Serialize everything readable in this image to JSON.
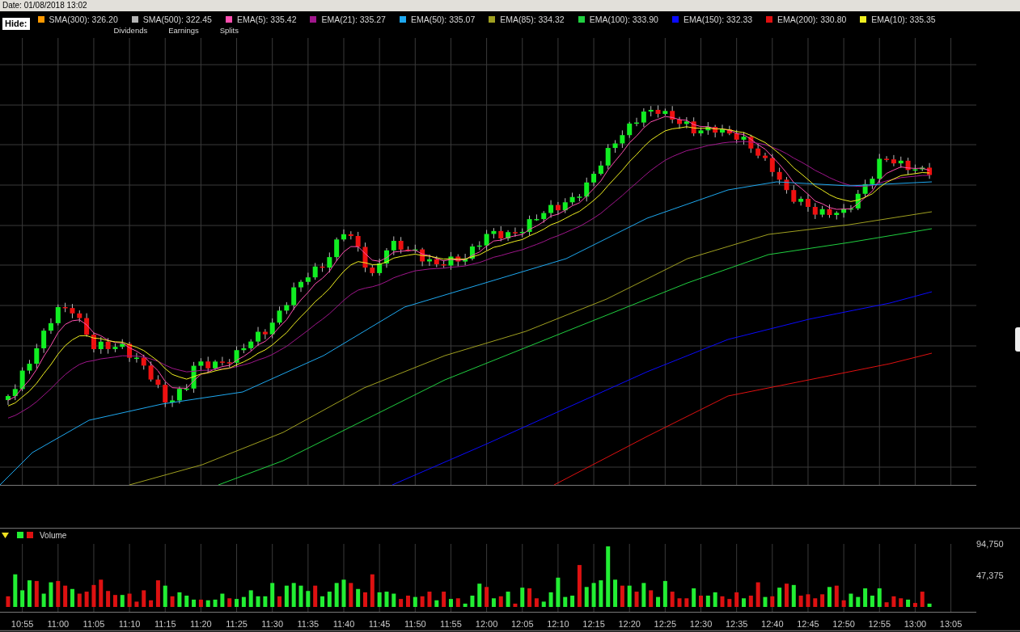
{
  "header": {
    "date": "Date: 01/08/2018 13:02"
  },
  "hide_button": "Hide:",
  "indicators": [
    {
      "label": "SMA(300): 326.20",
      "color": "#ff9900"
    },
    {
      "label": "SMA(500): 322.45",
      "color": "#b4b4b4"
    },
    {
      "label": "EMA(5): 335.42",
      "color": "#ff4fb0"
    },
    {
      "label": "EMA(21): 335.27",
      "color": "#a0168c"
    },
    {
      "label": "EMA(50): 335.07",
      "color": "#1ea8f0"
    },
    {
      "label": "EMA(85): 334.32",
      "color": "#a0a020"
    },
    {
      "label": "EMA(100): 333.90",
      "color": "#20d040"
    },
    {
      "label": "EMA(150): 332.33",
      "color": "#0a0aff"
    },
    {
      "label": "EMA(200): 330.80",
      "color": "#e01010"
    },
    {
      "label": "EMA(10): 335.35",
      "color": "#f0f020"
    }
  ],
  "events": [
    "Dividends",
    "Earnings",
    "Splits"
  ],
  "volume": {
    "chart_data": {
      "type": "bar",
      "stacked": true,
      "grid": true,
      "x": [
        653,
        654,
        655,
        656,
        657,
        658,
        659,
        660,
        661,
        662,
        663,
        664,
        665,
        666,
        667,
        668,
        669,
        670,
        671,
        672,
        673,
        674,
        675,
        676,
        677,
        678,
        679,
        680,
        681,
        682,
        683,
        684,
        685,
        686,
        687,
        688,
        689,
        690,
        691,
        692,
        693,
        694,
        695,
        696,
        697,
        698,
        699,
        700,
        701,
        702,
        703,
        704,
        705,
        706,
        707,
        708,
        709,
        710,
        711,
        712,
        713,
        714,
        715,
        716,
        717,
        718,
        719,
        720,
        721,
        722,
        723,
        724,
        725,
        726,
        727,
        728,
        729,
        730,
        731,
        732,
        733,
        734,
        735,
        736,
        737,
        738,
        739,
        740,
        741,
        742,
        743,
        744,
        745,
        746,
        747,
        748,
        749,
        750,
        751,
        752,
        753,
        754,
        755,
        756,
        757,
        758,
        759,
        760,
        761,
        762,
        763,
        764,
        765,
        766,
        767,
        768,
        769,
        770,
        771,
        772,
        773,
        774,
        775,
        776,
        777,
        778,
        779,
        780,
        781,
        782
      ],
      "xlim": [
        651.87,
        788.56
      ],
      "ylim": [
        0,
        110500
      ],
      "xticks": [
        {
          "value": 655,
          "label": "10:55"
        },
        {
          "value": 660,
          "label": "11:00"
        },
        {
          "value": 665,
          "label": "11:05"
        },
        {
          "value": 670,
          "label": "11:10"
        },
        {
          "value": 675,
          "label": "11:15"
        },
        {
          "value": 680,
          "label": "11:20"
        },
        {
          "value": 685,
          "label": "11:25"
        },
        {
          "value": 690,
          "label": "11:30"
        },
        {
          "value": 695,
          "label": "11:35"
        },
        {
          "value": 700,
          "label": "11:40"
        },
        {
          "value": 705,
          "label": "11:45"
        },
        {
          "value": 710,
          "label": "11:50"
        },
        {
          "value": 715,
          "label": "11:55"
        },
        {
          "value": 720,
          "label": "12:00"
        },
        {
          "value": 725,
          "label": "12:05"
        },
        {
          "value": 730,
          "label": "12:10"
        },
        {
          "value": 735,
          "label": "12:15"
        },
        {
          "value": 740,
          "label": "12:20"
        },
        {
          "value": 745,
          "label": "12:25"
        },
        {
          "value": 750,
          "label": "12:30"
        },
        {
          "value": 755,
          "label": "12:35"
        },
        {
          "value": 760,
          "label": "12:40"
        },
        {
          "value": 765,
          "label": "12:45"
        },
        {
          "value": 770,
          "label": "12:50"
        },
        {
          "value": 775,
          "label": "12:55"
        },
        {
          "value": 780,
          "label": "13:00"
        },
        {
          "value": 785,
          "label": "13:05"
        }
      ],
      "yticks": [
        {
          "value": 47375,
          "label": "47,375"
        },
        {
          "value": 94750,
          "label": "94,750"
        }
      ],
      "series": [
        {
          "color": "#22ee33",
          "values": [
            null,
            49000,
            25000,
            40000,
            null,
            20000,
            37000,
            null,
            null,
            27000,
            null,
            null,
            null,
            null,
            null,
            null,
            18000,
            null,
            null,
            null,
            null,
            null,
            32000,
            null,
            22000,
            17000,
            11000,
            null,
            10000,
            11000,
            20000,
            null,
            12000,
            15000,
            25000,
            16000,
            16000,
            36000,
            null,
            32000,
            36000,
            32000,
            24000,
            null,
            16000,
            23000,
            36000,
            41000,
            null,
            27000,
            null,
            null,
            22000,
            23000,
            20000,
            null,
            null,
            15000,
            null,
            null,
            10000,
            null,
            12000,
            null,
            5000,
            17000,
            35000,
            null,
            13000,
            null,
            23000,
            null,
            29000,
            null,
            null,
            8000,
            22000,
            44000,
            15000,
            17000,
            null,
            30000,
            36000,
            40000,
            91000,
            41000,
            null,
            32000,
            null,
            36000,
            null,
            15000,
            39000,
            null,
            null,
            null,
            28000,
            null,
            17000,
            22000,
            null,
            null,
            null,
            13000,
            null,
            null,
            15000,
            null,
            29000,
            null,
            33000,
            null,
            null,
            null,
            null,
            30000,
            null,
            null,
            20000,
            15000,
            28000,
            17000,
            28000,
            null,
            null,
            null,
            11000,
            null,
            null,
            5000
          ]
        },
        {
          "name": "Volume",
          "color": "#dd1111",
          "values": [
            16000,
            null,
            null,
            null,
            39000,
            null,
            null,
            39000,
            32000,
            null,
            20000,
            23000,
            33000,
            41000,
            24000,
            18000,
            null,
            20000,
            8000,
            25000,
            10000,
            40000,
            null,
            16000,
            null,
            null,
            null,
            11000,
            null,
            null,
            null,
            13000,
            null,
            null,
            null,
            null,
            null,
            null,
            16000,
            null,
            null,
            null,
            null,
            32000,
            null,
            null,
            null,
            null,
            36000,
            null,
            22000,
            49000,
            null,
            null,
            null,
            12000,
            17000,
            null,
            16000,
            23000,
            null,
            23000,
            null,
            13000,
            null,
            null,
            null,
            30000,
            null,
            16000,
            null,
            5000,
            null,
            28000,
            13000,
            null,
            null,
            null,
            null,
            null,
            63000,
            null,
            null,
            null,
            null,
            null,
            32000,
            null,
            23000,
            null,
            25000,
            null,
            null,
            23000,
            13000,
            13000,
            null,
            17000,
            null,
            null,
            16000,
            12000,
            22000,
            null,
            17000,
            37000,
            null,
            16000,
            null,
            35000,
            null,
            17000,
            19000,
            13000,
            19000,
            null,
            32000,
            10000,
            null,
            null,
            null,
            null,
            null,
            7000,
            16000,
            13000,
            null,
            6000,
            23000,
            null
          ]
        }
      ]
    }
  }
}
